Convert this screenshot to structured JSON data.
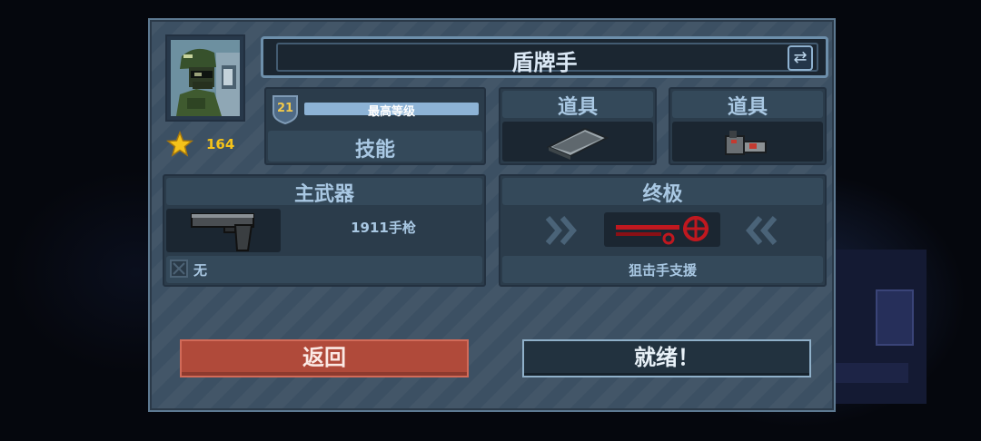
{
  "character": {
    "name": "盾牌手",
    "stars": "164",
    "level": "21",
    "level_bar_label": "最高等级",
    "skills_label": "技能"
  },
  "items": [
    {
      "label": "道具",
      "icon": "grey-plate-item-icon"
    },
    {
      "label": "道具",
      "icon": "grenade-item-icon"
    }
  ],
  "primary_weapon": {
    "section_label": "主武器",
    "name": "1911手枪",
    "secondary_label": "无"
  },
  "ultimate": {
    "section_label": "终极",
    "name": "狙击手支援"
  },
  "buttons": {
    "back": "返回",
    "ready": "就绪！"
  },
  "colors": {
    "panel": "#3c5063",
    "back_button": "#b04a3a",
    "level_bar": "#8db3d6",
    "ultimate_icon": "#c0181f",
    "star": "#f4c21a"
  }
}
